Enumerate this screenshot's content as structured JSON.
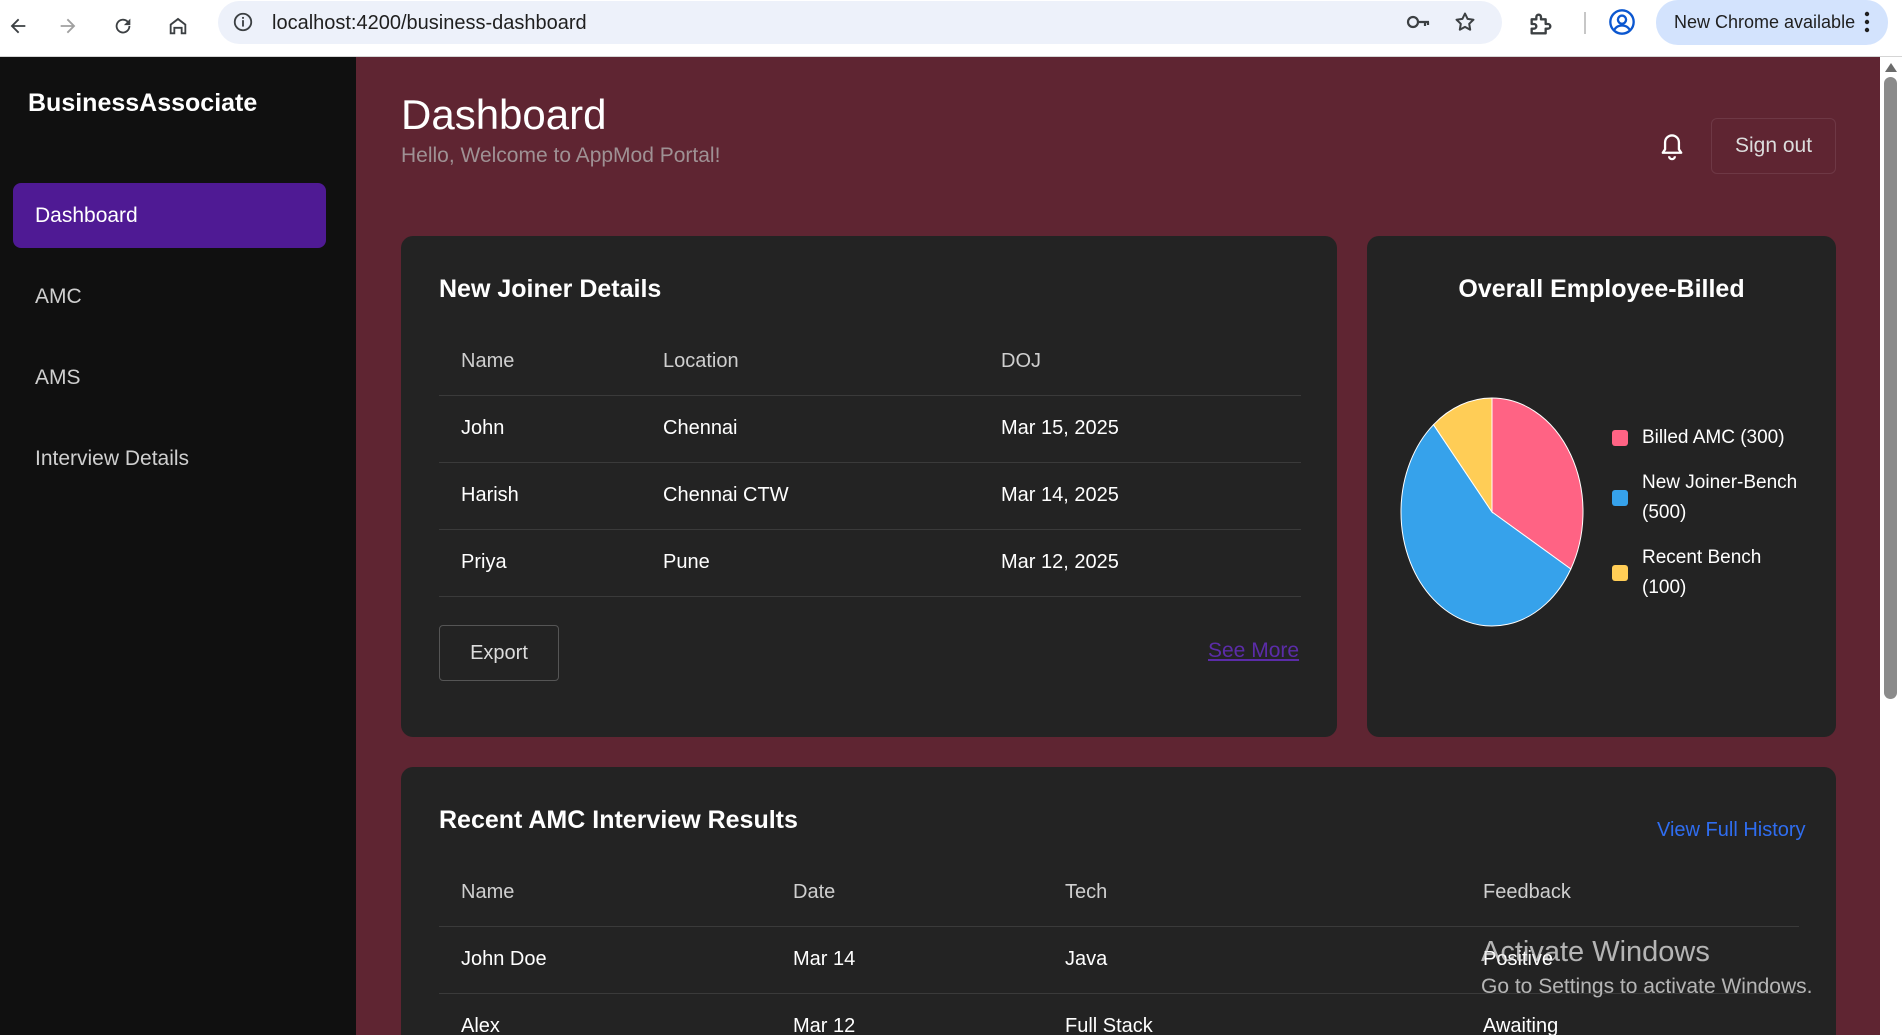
{
  "browser": {
    "url": "localhost:4200/business-dashboard",
    "update_label": "New Chrome available"
  },
  "sidebar": {
    "brand": "BusinessAssociate",
    "items": [
      {
        "label": "Dashboard",
        "active": true
      },
      {
        "label": "AMC",
        "active": false
      },
      {
        "label": "AMS",
        "active": false
      },
      {
        "label": "Interview Details",
        "active": false
      }
    ]
  },
  "header": {
    "title": "Dashboard",
    "subtitle": "Hello, Welcome to AppMod Portal!",
    "signout_label": "Sign out"
  },
  "new_joiners": {
    "title": "New Joiner Details",
    "columns": [
      "Name",
      "Location",
      "DOJ"
    ],
    "rows": [
      [
        "John",
        "Chennai",
        "Mar 15, 2025"
      ],
      [
        "Harish",
        "Chennai CTW",
        "Mar 14, 2025"
      ],
      [
        "Priya",
        "Pune",
        "Mar 12, 2025"
      ]
    ],
    "export_label": "Export",
    "see_more_label": "See More"
  },
  "employee_billed": {
    "title": "Overall Employee-Billed",
    "legend": [
      {
        "line1": "Billed AMC (300)",
        "line2": "",
        "color": "#ff6384"
      },
      {
        "line1": "New Joiner-Bench",
        "line2": "(500)",
        "color": "#36a2eb"
      },
      {
        "line1": "Recent Bench",
        "line2": "(100)",
        "color": "#ffcd56"
      }
    ]
  },
  "chart_data": {
    "type": "pie",
    "title": "Overall Employee-Billed",
    "categories": [
      "Billed AMC",
      "New Joiner-Bench",
      "Recent Bench"
    ],
    "values": [
      300,
      500,
      100
    ],
    "colors": [
      "#ff6384",
      "#36a2eb",
      "#ffcd56"
    ],
    "legend_position": "right"
  },
  "interviews": {
    "title": "Recent AMC Interview Results",
    "view_history_label": "View Full History",
    "columns": [
      "Name",
      "Date",
      "Tech",
      "Feedback"
    ],
    "rows": [
      [
        "John Doe",
        "Mar 14",
        "Java",
        "Positive"
      ],
      [
        "Alex",
        "Mar 12",
        "Full Stack",
        "Awaiting"
      ]
    ]
  },
  "watermark": {
    "line1": "Activate Windows",
    "line2": "Go to Settings to activate Windows."
  }
}
